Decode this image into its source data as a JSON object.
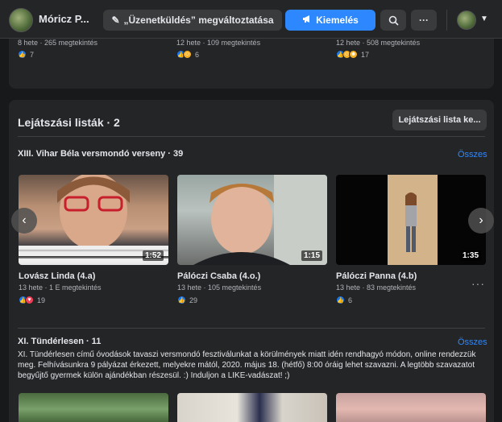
{
  "topbar": {
    "page_name": "Móricz P...",
    "edit_label": "„Üzenetküldés” megváltoztatása",
    "feature_label": "Kiemelés",
    "more_label": "···"
  },
  "prev_items": [
    {
      "meta": "8 hete · 265 megtekintés",
      "count": "7"
    },
    {
      "meta": "12 hete · 109 megtekintés",
      "count": "6"
    },
    {
      "meta": "12 hete · 508 megtekintés",
      "count": "17"
    }
  ],
  "playlists": {
    "title": "Lejátszási listák · 2",
    "create_label": "Lejátszási lista ke...",
    "list1": {
      "title": "XIII. Vihar Béla versmondó verseny · 39",
      "see_all": "Összes",
      "videos": [
        {
          "title": "Lovász Linda (4.a)",
          "meta": "13 hete · 1 E megtekintés",
          "count": "19",
          "duration": "1:52"
        },
        {
          "title": "Pálóczi Csaba (4.o.)",
          "meta": "13 hete · 105 megtekintés",
          "count": "29",
          "duration": "1:15"
        },
        {
          "title": "Pálóczi Panna (4.b)",
          "meta": "13 hete · 83 megtekintés",
          "count": "6",
          "duration": "1:35"
        }
      ]
    },
    "list2": {
      "title": "XI. Tündérlesen · 11",
      "see_all": "Összes",
      "description": "XI. Tündérlesen című óvodások tavaszi versmondó fesztiválunkat a körülmények miatt idén rendhagyó módon, online rendezzük meg. Felhívásunkra 9 pályázat érkezett, melyekre mától, 2020. május 18. (hétfő) 8:00 óráig lehet szavazni. A legtöbb szavazatot begyűjtő gyermek külön ajándékban részesül. :) Induljon a LIKE-vadászat! ;)"
    },
    "more_options": "···"
  }
}
